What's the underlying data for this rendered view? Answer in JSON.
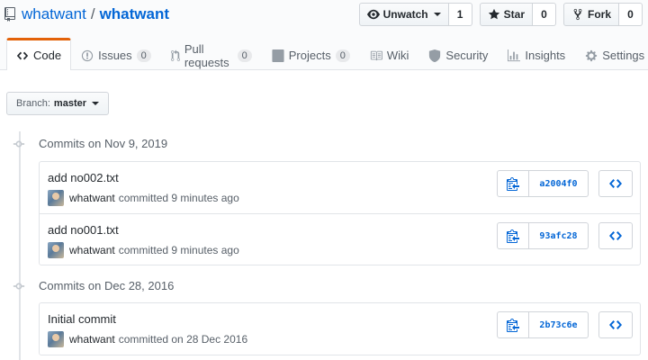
{
  "repo": {
    "owner": "whatwant",
    "separator": "/",
    "name": "whatwant"
  },
  "actions": {
    "watch": {
      "label": "Unwatch",
      "count": "1"
    },
    "star": {
      "label": "Star",
      "count": "0"
    },
    "fork": {
      "label": "Fork",
      "count": "0"
    }
  },
  "tabs": [
    {
      "label": "Code",
      "icon": "code-icon",
      "selected": true
    },
    {
      "label": "Issues",
      "icon": "issue-icon",
      "counter": "0"
    },
    {
      "label": "Pull requests",
      "icon": "pull-request-icon",
      "counter": "0"
    },
    {
      "label": "Projects",
      "icon": "project-icon",
      "counter": "0"
    },
    {
      "label": "Wiki",
      "icon": "book-icon"
    },
    {
      "label": "Security",
      "icon": "shield-icon"
    },
    {
      "label": "Insights",
      "icon": "graph-icon"
    },
    {
      "label": "Settings",
      "icon": "gear-icon"
    }
  ],
  "branch": {
    "prefix": "Branch:",
    "name": "master"
  },
  "commit_groups": [
    {
      "title": "Commits on Nov 9, 2019",
      "commits": [
        {
          "message": "add no002.txt",
          "author": "whatwant",
          "meta": "committed 9 minutes ago",
          "sha": "a2004f0"
        },
        {
          "message": "add no001.txt",
          "author": "whatwant",
          "meta": "committed 9 minutes ago",
          "sha": "93afc28"
        }
      ]
    },
    {
      "title": "Commits on Dec 28, 2016",
      "commits": [
        {
          "message": "Initial commit",
          "author": "whatwant",
          "meta": "committed on 28 Dec 2016",
          "sha": "2b73c6e"
        }
      ]
    }
  ],
  "colors": {
    "link": "#0366d6",
    "tab_accent": "#e36209",
    "muted": "#586069"
  }
}
